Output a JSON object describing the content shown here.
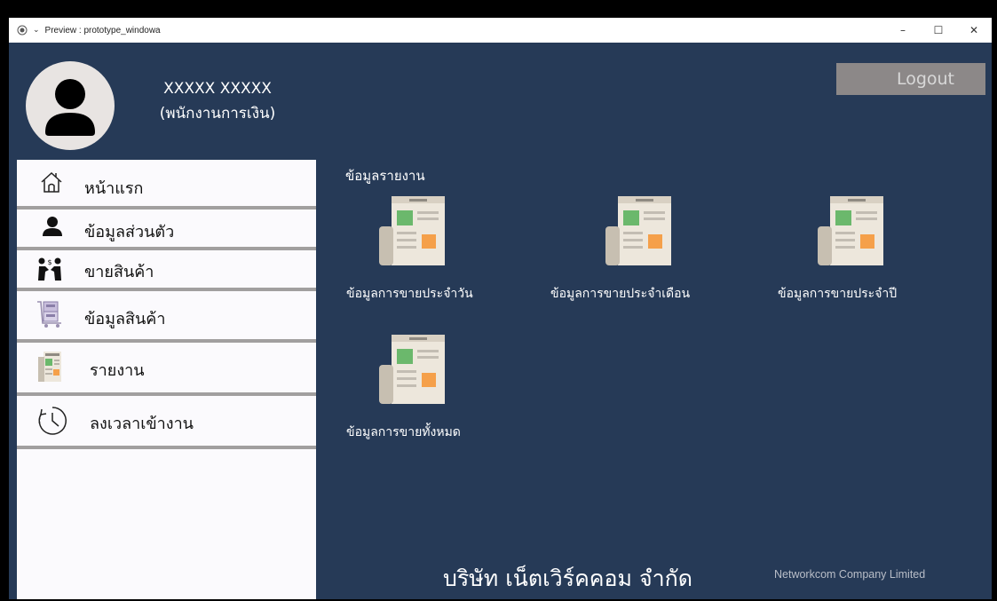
{
  "window": {
    "title": "Preview : prototype_windowa",
    "minimize": "–",
    "maximize": "☐",
    "close": "✕"
  },
  "user": {
    "name": "XXXXX XXXXX",
    "role": "(พนักงานการเงิน)"
  },
  "logout_label": "Logout",
  "sidebar": {
    "items": [
      {
        "label": "หน้าแรก",
        "icon": "home-icon"
      },
      {
        "label": "ข้อมูลส่วนตัว",
        "icon": "person-icon"
      },
      {
        "label": "ขายสินค้า",
        "icon": "sell-icon"
      },
      {
        "label": "ข้อมูลสินค้า",
        "icon": "cart-icon"
      },
      {
        "label": "รายงาน",
        "icon": "report-icon"
      },
      {
        "label": "ลงเวลาเข้างาน",
        "icon": "clock-icon"
      }
    ]
  },
  "section_title": "ข้อมูลรายงาน",
  "reports": [
    {
      "label": "ข้อมูลการขายประจำวัน",
      "icon": "newspaper-icon"
    },
    {
      "label": "ข้อมูลการขายประจำเดือน",
      "icon": "newspaper-icon"
    },
    {
      "label": "ข้อมูลการขายประจำปี",
      "icon": "newspaper-icon"
    },
    {
      "label": "ข้อมูลการขายทั้งหมด",
      "icon": "newspaper-icon"
    }
  ],
  "company": {
    "thai": "บริษัท เน็ตเวิร์คคอม จำกัด",
    "english": "Networkcom Company Limited"
  },
  "colors": {
    "background": "#263a57",
    "sidebar": "#fbfafd",
    "logout": "#8c8888",
    "separator": "#a19f9f"
  }
}
